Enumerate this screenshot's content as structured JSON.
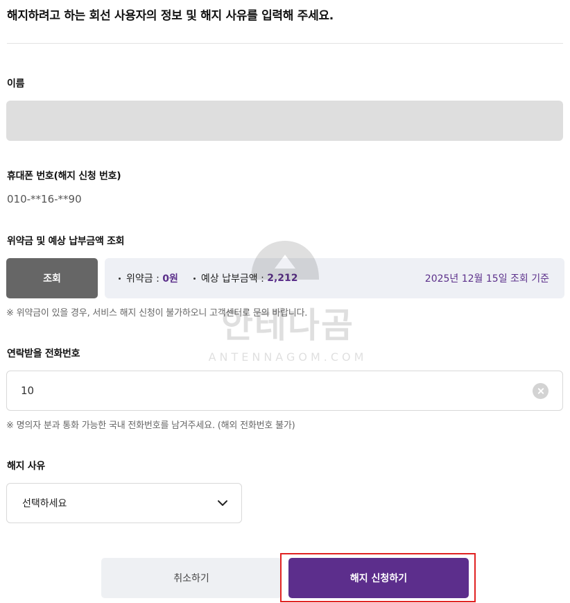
{
  "heading": "해지하려고 하는 회선 사용자의 정보 및 해지 사유를 입력해 주세요.",
  "name_section": {
    "label": "이름",
    "value": ""
  },
  "phone_section": {
    "label": "휴대폰 번호(해지 신청 번호)",
    "value": "010-**16-**90"
  },
  "lookup_section": {
    "label": "위약금 및 예상 납부금액 조회",
    "button_label": "조회",
    "penalty_label": "위약금 : ",
    "penalty_value": "0원",
    "expected_label": "예상 납부금액 : ",
    "expected_value": "2,212",
    "date_text": "2025년 12월 15일 조회 기준",
    "note": "※ 위약금이 있을 경우, 서비스 해지 신청이 불가하오니 고객센터로 문의 바랍니다."
  },
  "contact_section": {
    "label": "연락받을 전화번호",
    "value": "10",
    "note": "※ 명의자 분과 통화 가능한 국내 전화번호를 남겨주세요. (해외 전화번호 불가)"
  },
  "reason_section": {
    "label": "해지 사유",
    "selected": "선택하세요"
  },
  "actions": {
    "cancel_label": "취소하기",
    "submit_label": "해지 신청하기"
  },
  "watermark": {
    "korean": "안테나곰",
    "english": "ANTENNAGOM.COM"
  },
  "colors": {
    "accent": "#5c2e8c",
    "highlight": "#e02020"
  }
}
